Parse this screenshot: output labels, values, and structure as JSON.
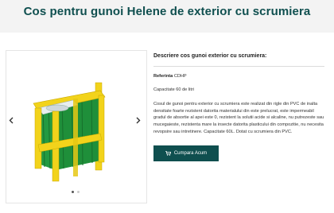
{
  "page": {
    "title": "Cos pentru gunoi Helene de exterior cu scrumiera"
  },
  "gallery": {
    "active_dot": 0,
    "dot_count": 2
  },
  "product": {
    "desc_heading": "Descriere cos gunoi exterior cu scrumiera:",
    "ref_label": "Referinta",
    "ref_value": "CDHP",
    "capacity": "Capacitate 60 de litri",
    "body": "Cosul de gunoi pentru exterior cu scrumiera este realizat din rigle din PVC de inaltа densitate foarte rezistent datorita materialului din este  prelucrat, este impermeabil gradul de absortie al apei este 0, rezistent la solutii acide si alcaline, nu putrezeste sau mucegaieste, rezistenta mare la insecte datorita plasticului din compozitie, nu necesita revopsire sau intretinere. Capacitate 60L. Dotat cu scrumiera din PVC.",
    "buy_label": "Cumpara Acum"
  },
  "colors": {
    "brand": "#0f4f4f",
    "bin_green": "#1f8f3a",
    "frame_yellow": "#f2d31b"
  },
  "icons": {
    "prev": "chevron-left-icon",
    "next": "chevron-right-icon",
    "cart": "cart-icon"
  }
}
